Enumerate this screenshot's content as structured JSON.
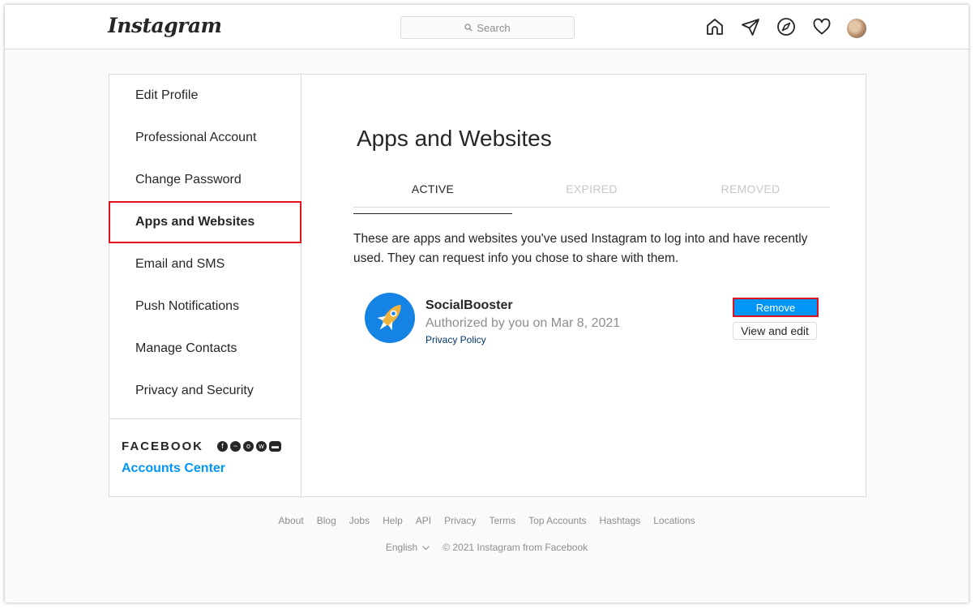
{
  "header": {
    "logo": "Instagram",
    "search_placeholder": "Search"
  },
  "sidebar": {
    "items": [
      {
        "label": "Edit Profile"
      },
      {
        "label": "Professional Account"
      },
      {
        "label": "Change Password"
      },
      {
        "label": "Apps and Websites",
        "active": true
      },
      {
        "label": "Email and SMS"
      },
      {
        "label": "Push Notifications"
      },
      {
        "label": "Manage Contacts"
      },
      {
        "label": "Privacy and Security"
      }
    ],
    "facebook_label": "FACEBOOK",
    "accounts_center": "Accounts Center"
  },
  "main": {
    "title": "Apps and Websites",
    "tabs": [
      {
        "label": "ACTIVE",
        "active": true
      },
      {
        "label": "EXPIRED"
      },
      {
        "label": "REMOVED"
      }
    ],
    "description": "These are apps and websites you've used Instagram to log into and have recently used. They can request info you chose to share with them.",
    "app": {
      "name": "SocialBooster",
      "authorized": "Authorized by you on Mar 8, 2021",
      "policy": "Privacy Policy",
      "remove_label": "Remove",
      "edit_label": "View and edit"
    }
  },
  "footer": {
    "links": [
      "About",
      "Blog",
      "Jobs",
      "Help",
      "API",
      "Privacy",
      "Terms",
      "Top Accounts",
      "Hashtags",
      "Locations"
    ],
    "language": "English",
    "copyright": "© 2021 Instagram from Facebook"
  },
  "colors": {
    "accent": "#0095f6",
    "highlight": "#e0121c",
    "app_icon_bg": "#1583e4"
  }
}
